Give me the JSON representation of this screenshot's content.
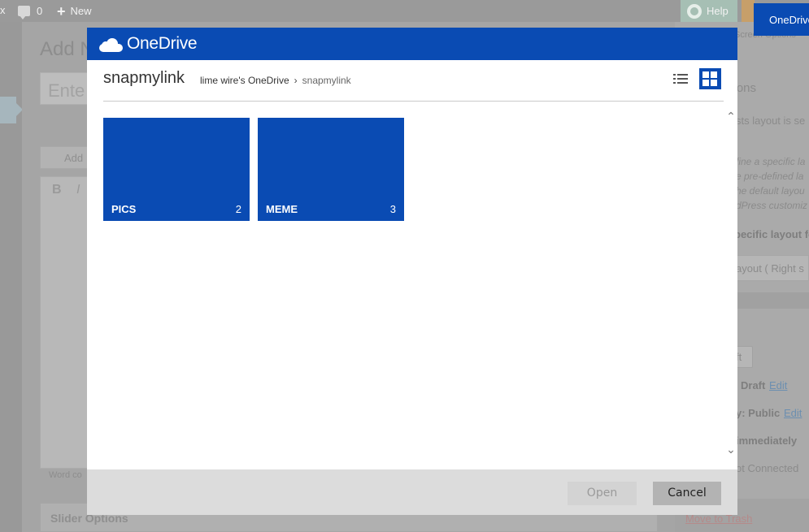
{
  "admin_bar": {
    "x_glyph": "x",
    "comment_count": "0",
    "new_label": "New",
    "help_label": "Help"
  },
  "onedrive_tab": "OneDrive",
  "background": {
    "add_new": "Add N",
    "enter_title": "Ente",
    "add_media": "Add",
    "bold": "B",
    "italic": "I",
    "word_count": "Word co",
    "slider_options": "Slider Options",
    "right_panel": {
      "screen_options": "Screen Options",
      "options_title": "ptions",
      "layout_text": "sts layout is se",
      "line1": "fine a specific la",
      "line2": "e pre-defined la",
      "line3": "he default layou",
      "line4": "dPress customiz",
      "specific_layout": "pecific layout fo",
      "layout_select": "ayout ( Right s",
      "draft_button": "ft",
      "status_label": "Draft",
      "status_edit": "Edit",
      "visibility_label": "y: Public",
      "visibility_edit": "Edit",
      "publish": "immediately",
      "not_connected": "ot Connected",
      "move_to_trash": "Move to Trash"
    }
  },
  "modal": {
    "brand": "OneDrive",
    "folder_title": "snapmylink",
    "breadcrumb": {
      "root": "lime wire's OneDrive",
      "separator": "›",
      "current": "snapmylink"
    },
    "folders": [
      {
        "name": "PICS",
        "count": "2"
      },
      {
        "name": "MEME",
        "count": "3"
      }
    ],
    "open_label": "Open",
    "cancel_label": "Cancel",
    "accent_color": "#0a4bb3"
  }
}
